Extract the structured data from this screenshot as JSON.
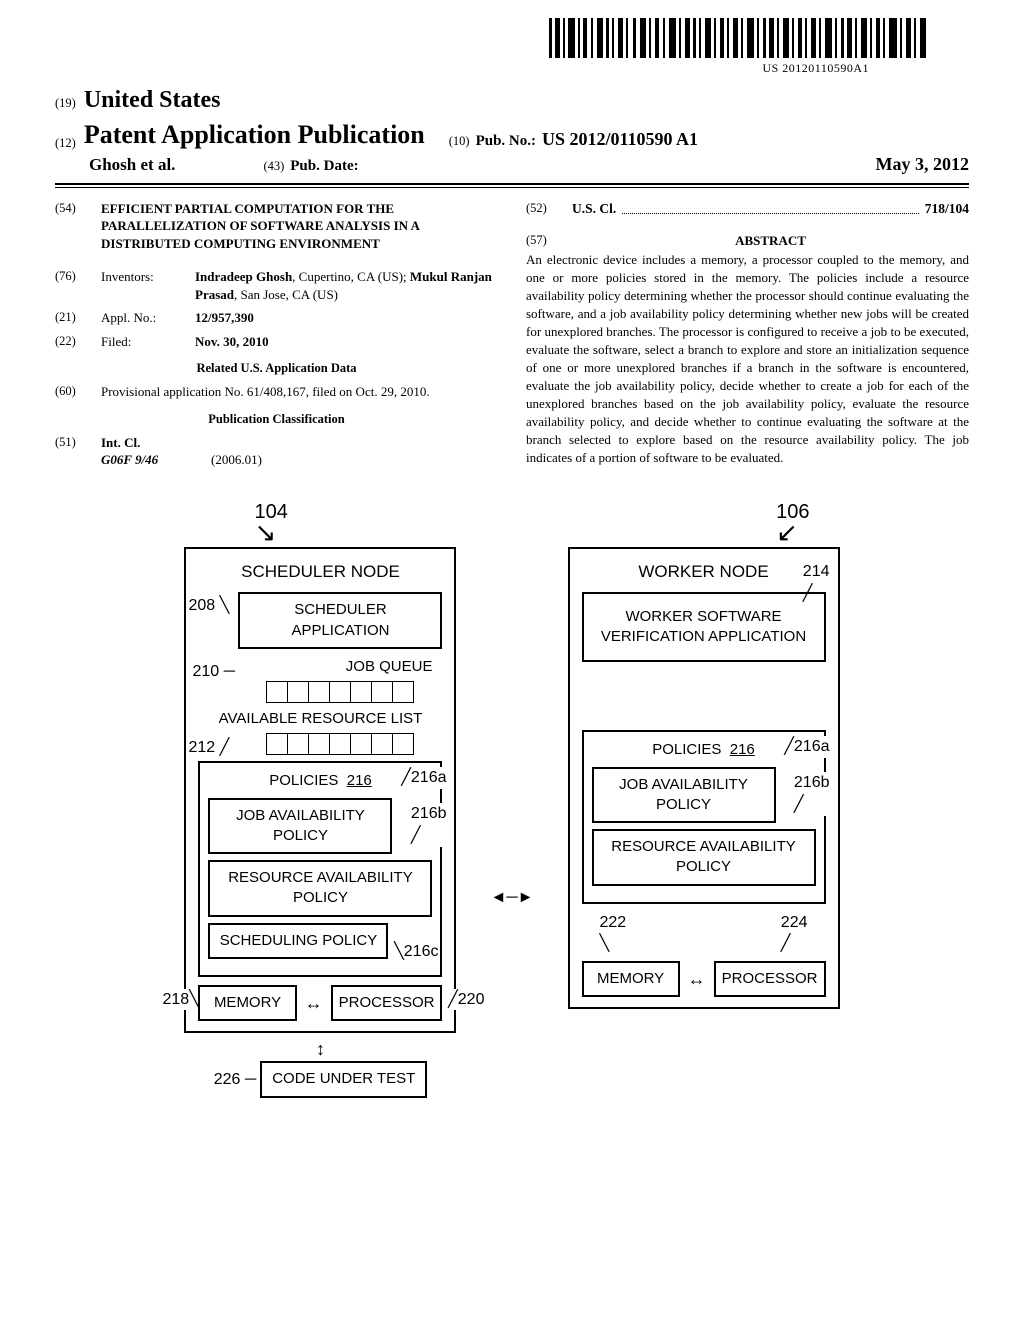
{
  "barcode_number": "US 20120110590A1",
  "country_line": {
    "code": "(19)",
    "value": "United States"
  },
  "pub_line": {
    "code": "(12)",
    "value": "Patent Application Publication"
  },
  "author_line": "Ghosh et al.",
  "pubno": {
    "code": "(10)",
    "label": "Pub. No.:",
    "value": "US 2012/0110590 A1"
  },
  "pubdate": {
    "code": "(43)",
    "label": "Pub. Date:",
    "value": "May 3, 2012"
  },
  "title": {
    "code": "(54)",
    "value": "EFFICIENT PARTIAL COMPUTATION FOR THE PARALLELIZATION OF SOFTWARE ANALYSIS IN A DISTRIBUTED COMPUTING ENVIRONMENT"
  },
  "inventors": {
    "code": "(76)",
    "label": "Inventors:",
    "value": "Indradeep Ghosh, Cupertino, CA (US); Mukul Ranjan Prasad, San Jose, CA (US)"
  },
  "appl": {
    "code": "(21)",
    "label": "Appl. No.:",
    "value": "12/957,390"
  },
  "filed": {
    "code": "(22)",
    "label": "Filed:",
    "value": "Nov. 30, 2010"
  },
  "related_heading": "Related U.S. Application Data",
  "provisional": {
    "code": "(60)",
    "value": "Provisional application No. 61/408,167, filed on Oct. 29, 2010."
  },
  "classification_heading": "Publication Classification",
  "intcl": {
    "code": "(51)",
    "label": "Int. Cl.",
    "class": "G06F 9/46",
    "year": "(2006.01)"
  },
  "uscl": {
    "code": "(52)",
    "label": "U.S. Cl.",
    "value": "718/104"
  },
  "abstract_heading": {
    "code": "(57)",
    "label": "ABSTRACT"
  },
  "abstract": "An electronic device includes a memory, a processor coupled to the memory, and one or more policies stored in the memory. The policies include a resource availability policy determining whether the processor should continue evaluating the software, and a job availability policy determining whether new jobs will be created for unexplored branches. The processor is configured to receive a job to be executed, evaluate the software, select a branch to explore and store an initialization sequence of one or more unexplored branches if a branch in the software is encountered, evaluate the job availability policy, decide whether to create a job for each of the unexplored branches based on the job availability policy, evaluate the resource availability policy, and decide whether to continue evaluating the software at the branch selected to explore based on the resource availability policy. The job indicates of a portion of software to be evaluated.",
  "fig": {
    "ref104": "104",
    "ref106": "106",
    "ref208": "208",
    "ref210": "210",
    "ref212": "212",
    "ref214": "214",
    "ref216": "216",
    "ref216a": "216a",
    "ref216b": "216b",
    "ref216c": "216c",
    "ref218": "218",
    "ref220": "220",
    "ref222": "222",
    "ref224": "224",
    "ref226": "226",
    "scheduler_node": "SCHEDULER NODE",
    "scheduler_app": "SCHEDULER APPLICATION",
    "job_queue": "JOB QUEUE",
    "avail_list": "AVAILABLE RESOURCE LIST",
    "policies": "POLICIES",
    "job_policy": "JOB AVAILABILITY POLICY",
    "res_policy": "RESOURCE AVAILABILITY POLICY",
    "sched_policy": "SCHEDULING POLICY",
    "memory": "MEMORY",
    "processor": "PROCESSOR",
    "code_under_test": "CODE UNDER TEST",
    "worker_node": "WORKER NODE",
    "worker_app": "WORKER SOFTWARE VERIFICATION APPLICATION"
  }
}
